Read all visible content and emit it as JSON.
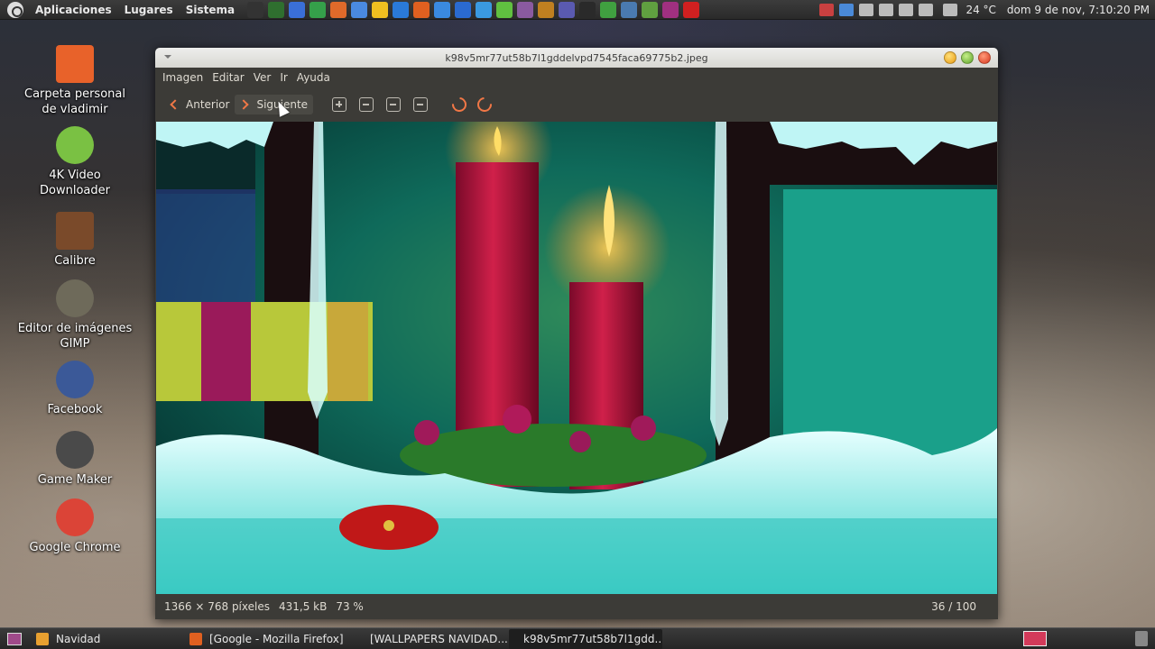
{
  "top_panel": {
    "menus": [
      "Aplicaciones",
      "Lugares",
      "Sistema"
    ],
    "launcher_colors": [
      "#333333",
      "#2f6f2f",
      "#3a6fd8",
      "#35a04a",
      "#e06a2a",
      "#4a8ae0",
      "#f0c020",
      "#2a7ad8",
      "#e06020",
      "#3a8ae0",
      "#2a6ad0",
      "#3a9ae0",
      "#60c040",
      "#8a5aa0",
      "#c08020",
      "#5a5ab0",
      "#2a2a2a",
      "#40a040",
      "#4a7ab0",
      "#60a040",
      "#a03080",
      "#d02020"
    ],
    "weather": "24 °C",
    "clock": "dom  9 de nov,  7:10:20 PM"
  },
  "desktop_icons": [
    {
      "label": "Carpeta personal de vladimir",
      "icon": "home-folder-icon",
      "color": "#e8622a"
    },
    {
      "label": "4K Video Downloader",
      "icon": "4k-video-downloader-icon",
      "color": "#7ac143"
    },
    {
      "label": "Calibre",
      "icon": "calibre-books-icon",
      "color": "#7a4a2a"
    },
    {
      "label": "Editor de imágenes GIMP",
      "icon": "gimp-icon",
      "color": "#6e6a5a"
    },
    {
      "label": "Facebook",
      "icon": "facebook-icon",
      "color": "#3b5998"
    },
    {
      "label": "Game Maker",
      "icon": "game-maker-icon",
      "color": "#4a4a4a"
    },
    {
      "label": "Google Chrome",
      "icon": "google-chrome-icon",
      "color": "#db4437"
    }
  ],
  "window": {
    "title": "k98v5mr77ut58b7l1gddelvpd7545faca69775b2.jpeg",
    "menus": [
      "Imagen",
      "Editar",
      "Ver",
      "Ir",
      "Ayuda"
    ],
    "toolbar": {
      "prev_label": "Anterior",
      "next_label": "Siguiente"
    },
    "status": {
      "dimensions": "1366 × 768 píxeles",
      "size": "431,5 kB",
      "zoom": "73 %",
      "position": "36 / 100"
    }
  },
  "taskbar": {
    "tasks": [
      {
        "label": "Navidad",
        "icon": "folder-icon",
        "color": "#e8a030",
        "active": false
      },
      {
        "label": "[Google - Mozilla Firefox]",
        "icon": "firefox-icon",
        "color": "#e06020",
        "active": false
      },
      {
        "label": "[WALLPAPERS NAVIDAD...",
        "icon": "document-icon",
        "color": "#3a6fd8",
        "active": false
      },
      {
        "label": "k98v5mr77ut58b7l1gdd...",
        "icon": "image-viewer-icon",
        "color": "#9a9a9a",
        "active": true
      }
    ]
  },
  "accent": "#f07746"
}
